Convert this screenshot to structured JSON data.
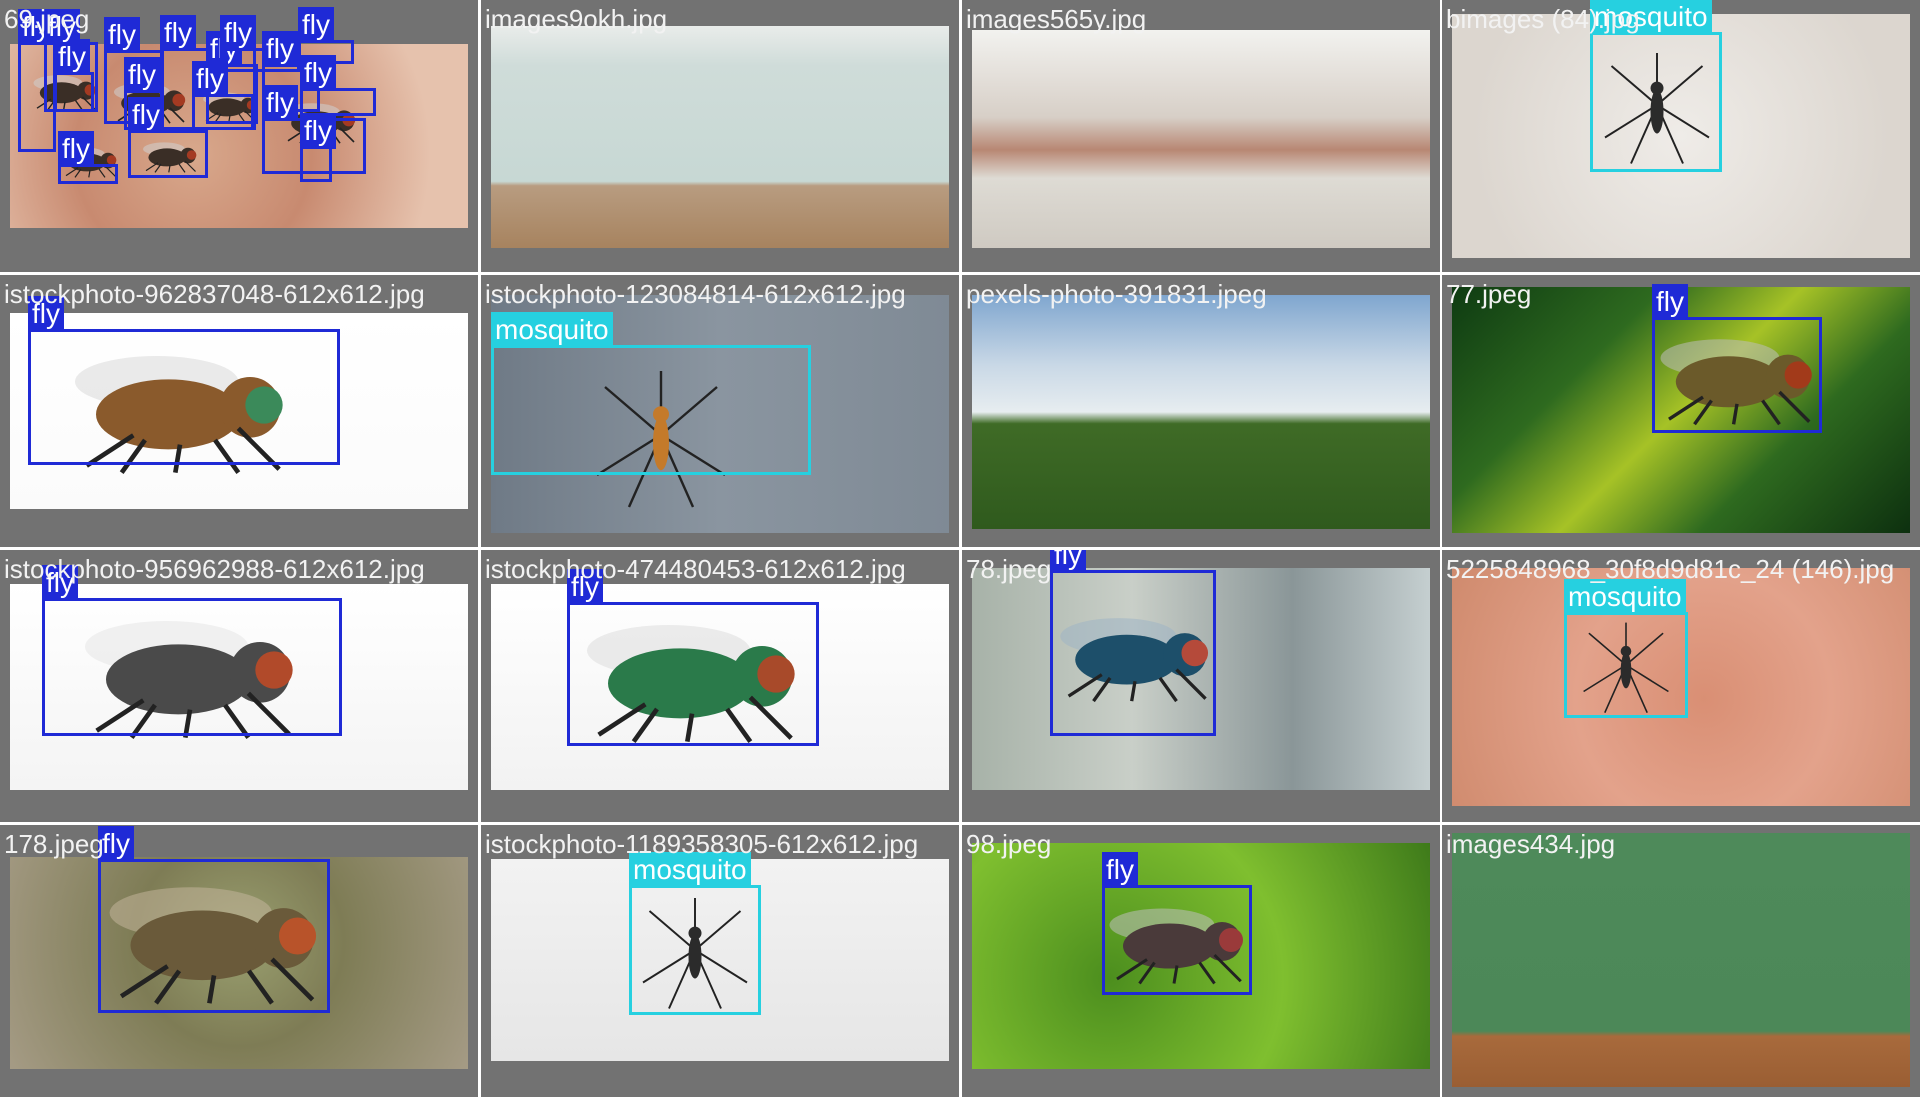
{
  "classes": {
    "fly": "fly",
    "mosquito": "mosquito"
  },
  "colors": {
    "fly": "#1f2ad6",
    "mosquito": "#26d0e0",
    "background": "#727272"
  },
  "tiles": [
    {
      "filename": "69.jpeg",
      "scene": "cluster of flies on skin",
      "detections": [
        "fly",
        "fly",
        "fly",
        "fly",
        "fly",
        "fly",
        "fly",
        "fly",
        "fly",
        "fly",
        "fly",
        "fly",
        "fly",
        "fly",
        "fly"
      ]
    },
    {
      "filename": "images9okh.jpg",
      "scene": "empty white room",
      "detections": []
    },
    {
      "filename": "images565y.jpg",
      "scene": "brick loft room",
      "detections": []
    },
    {
      "filename": "bimages (84).jpg",
      "scene": "mosquito and larvae",
      "detections": [
        "mosquito"
      ]
    },
    {
      "filename": "istockphoto-962837048-612x612.jpg",
      "scene": "horsefly on white",
      "detections": [
        "fly"
      ]
    },
    {
      "filename": "istockphoto-123084814-612x612.jpg",
      "scene": "mosquito close-up",
      "detections": [
        "mosquito"
      ]
    },
    {
      "filename": "pexels-photo-391831.jpeg",
      "scene": "green field and sky",
      "detections": []
    },
    {
      "filename": "77.jpeg",
      "scene": "fly on green leaf",
      "detections": [
        "fly"
      ]
    },
    {
      "filename": "istockphoto-956962988-612x612.jpg",
      "scene": "house fly on white",
      "detections": [
        "fly"
      ]
    },
    {
      "filename": "istockphoto-474480453-612x612.jpg",
      "scene": "green bottle fly",
      "detections": [
        "fly"
      ]
    },
    {
      "filename": "78.jpeg",
      "scene": "blue fly on flower",
      "detections": [
        "fly"
      ]
    },
    {
      "filename": "5225848968_30f8d9d81c_24 (146).jpg",
      "scene": "mosquito on skin",
      "detections": [
        "mosquito"
      ]
    },
    {
      "filename": "178.jpeg",
      "scene": "fly face close-up",
      "detections": [
        "fly"
      ]
    },
    {
      "filename": "istockphoto-1189358305-612x612.jpg",
      "scene": "mosquito on white",
      "detections": [
        "mosquito"
      ]
    },
    {
      "filename": "98.jpeg",
      "scene": "fly on green leaf",
      "detections": [
        "fly"
      ]
    },
    {
      "filename": "images434.jpg",
      "scene": "green room with door",
      "detections": []
    }
  ]
}
